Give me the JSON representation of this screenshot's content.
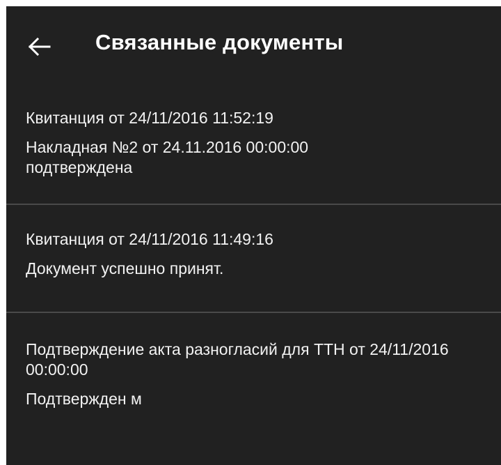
{
  "app_bar": {
    "title": "Связанные документы",
    "back_icon": "arrow-back-icon"
  },
  "documents": [
    {
      "title": "Квитанция от 24/11/2016 11:52:19",
      "status": "Накладная №2 от 24.11.2016 00:00:00 подтверждена"
    },
    {
      "title": "Квитанция от 24/11/2016 11:49:16",
      "status": "Документ успешно принят."
    },
    {
      "title": "Подтверждение акта разногласий для ТТН от 24/11/2016 00:00:00",
      "status": "Подтвержден м"
    }
  ],
  "colors": {
    "background": "#212121",
    "text": "#ffffff",
    "divider": "#4a4a4a"
  }
}
